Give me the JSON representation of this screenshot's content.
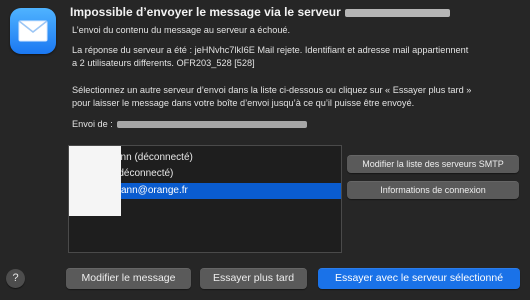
{
  "dialog": {
    "title": "Impossible d’envoyer le message via le serveur",
    "line1": "L’envoi du contenu du message au serveur a échoué.",
    "server_response_a": "La réponse du serveur a été : jeHNvhc7lkI6E Mail rejete. Identifiant et adresse mail appartiennent",
    "server_response_b": "a 2 utilisateurs differents. OFR203_528 [528]",
    "instructions_a": "Sélectionnez un autre serveur d’envoi dans la liste ci-dessous ou cliquez sur « Essayer plus tard »",
    "instructions_b": "pour laisser le message dans votre boîte d’envoi jusqu’à ce qu’il puisse être envoyé.",
    "sent_label": "Envoi de :"
  },
  "servers": {
    "items": [
      {
        "label": "ann (déconnecté)"
      },
      {
        "label": "(déconnecté)"
      },
      {
        "label": "ann@orange.fr"
      }
    ],
    "selected_index": 2
  },
  "buttons": {
    "smtp_list": "Modifier la liste des serveurs SMTP",
    "connection_info": "Informations de connexion",
    "modify_message": "Modifier le message",
    "try_later": "Essayer plus tard",
    "try_selected": "Essayer avec le serveur sélectionné",
    "help": "?"
  },
  "colors": {
    "background": "#262626",
    "accent": "#1a72e8",
    "selection": "#0a5ccf"
  },
  "icons": {
    "app": "mail-envelope-icon",
    "help": "question-mark-icon"
  }
}
